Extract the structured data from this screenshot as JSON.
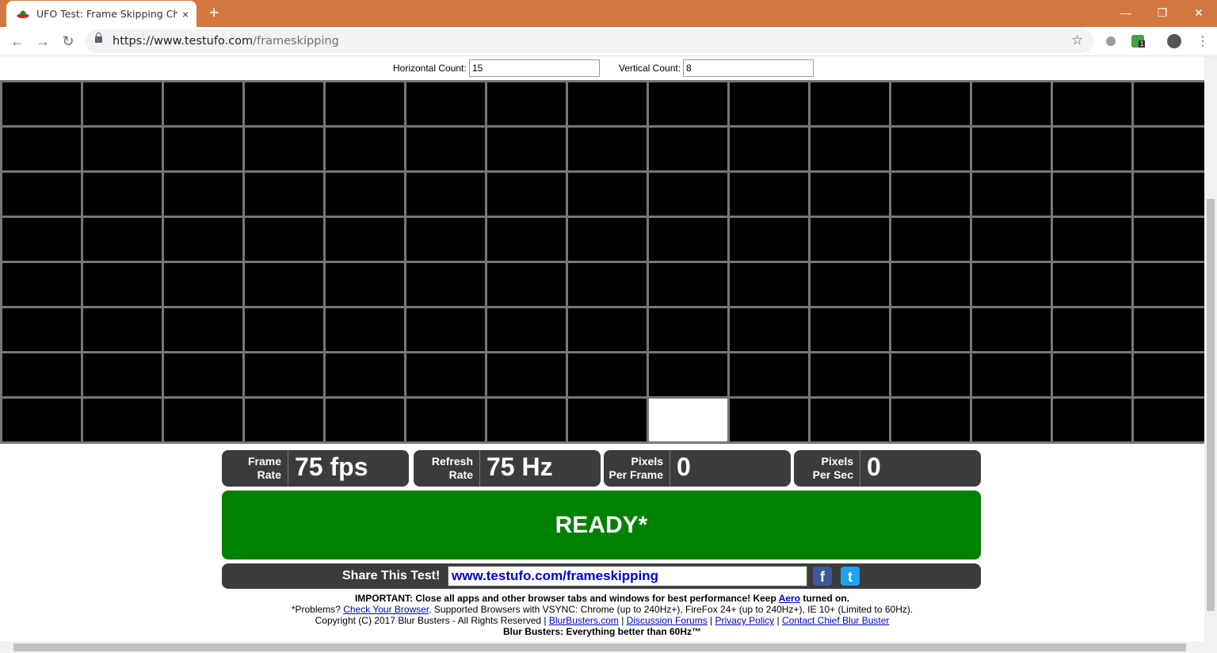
{
  "browser": {
    "tab_title": "UFO Test: Frame Skipping Checker",
    "url_host": "https://www.testufo.com",
    "url_path": "/frameskipping",
    "new_tab": "+",
    "close": "×",
    "extension_badge": "1",
    "accent": "#d2773f"
  },
  "controls": {
    "horizontal_label": "Horizontal Count:",
    "horizontal_value": "15",
    "vertical_label": "Vertical Count:",
    "vertical_value": "8"
  },
  "grid": {
    "columns": 15,
    "rows": 8,
    "lit_cell": {
      "row": 7,
      "col": 8
    }
  },
  "stats": [
    {
      "label_line1": "Frame",
      "label_line2": "Rate",
      "value": "75 fps"
    },
    {
      "label_line1": "Refresh",
      "label_line2": "Rate",
      "value": "75 Hz"
    },
    {
      "label_line1": "Pixels",
      "label_line2": "Per Frame",
      "value": "0"
    },
    {
      "label_line1": "Pixels",
      "label_line2": "Per Sec",
      "value": "0"
    }
  ],
  "status": {
    "text": "READY*",
    "color": "#008000"
  },
  "share": {
    "label": "Share This Test!",
    "url": "www.testufo.com/frameskipping",
    "facebook": "f",
    "twitter": "t"
  },
  "footer": {
    "important_prefix": "IMPORTANT: Close all apps and other browser tabs and windows for best performance! Keep ",
    "aero": "Aero",
    "important_suffix": " turned on.",
    "problems_prefix": "*Problems? ",
    "check_browser": "Check Your Browser",
    "problems_suffix": ". Supported Browsers with VSYNC: Chrome (up to 240Hz+), FireFox 24+ (up to 240Hz+), IE 10+ (Limited to 60Hz).",
    "copyright": "Copyright (C) 2017 Blur Busters - All Rights Reserved | ",
    "link_blurbusters": "BlurBusters.com",
    "link_forums": "Discussion Forums",
    "link_privacy": "Privacy Policy",
    "link_contact": "Contact Chief Blur Buster",
    "sep": " | ",
    "tagline": "Blur Busters: Everything better than 60Hz™"
  }
}
